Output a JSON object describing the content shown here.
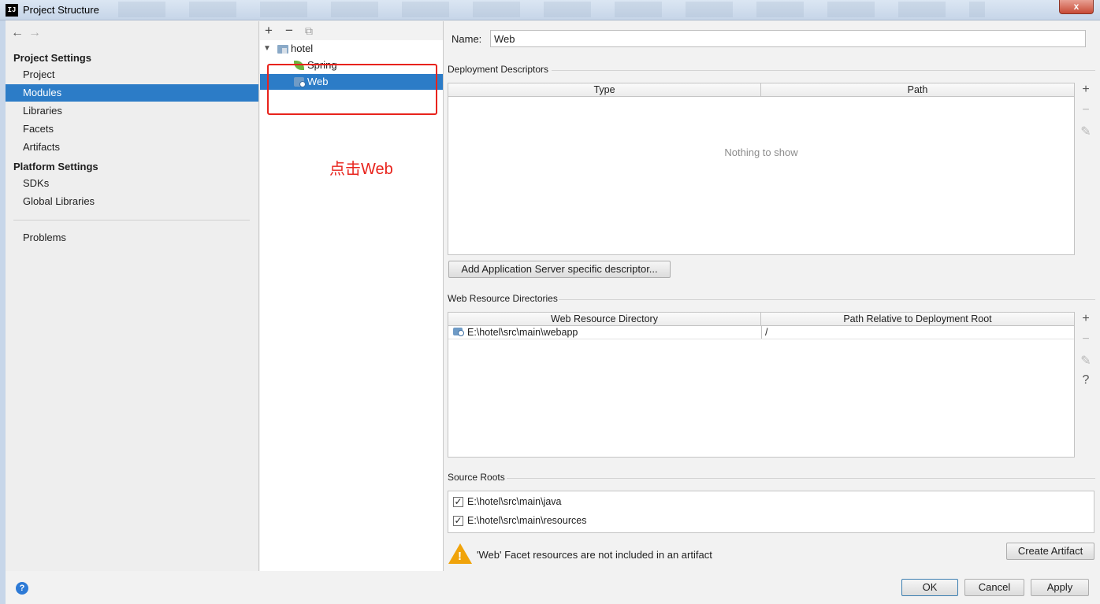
{
  "window": {
    "title": "Project Structure",
    "logo_text": "IJ",
    "close_label": "x"
  },
  "nav": {
    "back": "←",
    "forward": "→"
  },
  "left_panel": {
    "project_settings_header": "Project Settings",
    "project_items": [
      "Project",
      "Modules",
      "Libraries",
      "Facets",
      "Artifacts"
    ],
    "platform_settings_header": "Platform Settings",
    "platform_items": [
      "SDKs",
      "Global Libraries"
    ],
    "problems": "Problems",
    "selected": "Modules"
  },
  "tree": {
    "toolbar": {
      "add": "+",
      "remove": "−",
      "copy": "⧉"
    },
    "module": "hotel",
    "facets": [
      "Spring",
      "Web"
    ],
    "selected": "Web"
  },
  "annotation": {
    "text": "点击Web",
    "color": "#e8231c"
  },
  "details": {
    "name_label": "Name:",
    "name_value": "Web",
    "deployment_descriptors": {
      "title": "Deployment Descriptors",
      "columns": [
        "Type",
        "Path"
      ],
      "empty_text": "Nothing to show",
      "add_button": "Add Application Server specific descriptor..."
    },
    "web_resource_directories": {
      "title": "Web Resource Directories",
      "columns": [
        "Web Resource Directory",
        "Path Relative to Deployment Root"
      ],
      "rows": [
        {
          "directory": "E:\\hotel\\src\\main\\webapp",
          "relative": "/"
        }
      ]
    },
    "source_roots": {
      "title": "Source Roots",
      "items": [
        {
          "path": "E:\\hotel\\src\\main\\java",
          "checked": true
        },
        {
          "path": "E:\\hotel\\src\\main\\resources",
          "checked": true
        }
      ]
    },
    "warning": "'Web' Facet resources are not included in an artifact",
    "create_artifact_button": "Create Artifact"
  },
  "side_tools": {
    "add": "+",
    "remove": "−",
    "edit": "✎",
    "help": "?"
  },
  "footer": {
    "ok": "OK",
    "cancel": "Cancel",
    "apply": "Apply",
    "help": "?"
  },
  "colors": {
    "selection": "#2c7cc7",
    "annotation": "#e8231c",
    "warning": "#f0a30a"
  }
}
